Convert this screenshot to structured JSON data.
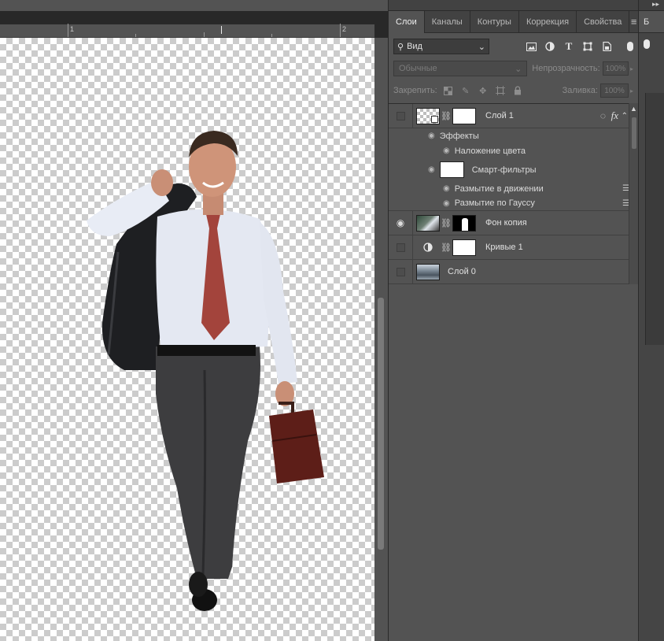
{
  "panel": {
    "tabs": [
      {
        "label": "Слои",
        "active": true
      },
      {
        "label": "Каналы",
        "active": false
      },
      {
        "label": "Контуры",
        "active": false
      },
      {
        "label": "Коррекция",
        "active": false
      },
      {
        "label": "Свойства",
        "active": false
      }
    ],
    "menu_icon": "hamburger-menu-icon",
    "filter": {
      "label": "Вид",
      "icons": [
        "image-filter-icon",
        "adjustment-filter-icon",
        "type-filter-icon",
        "shape-filter-icon",
        "smart-object-filter-icon"
      ]
    },
    "blend_mode": "Обычные",
    "opacity": {
      "label": "Непрозрачность:",
      "value": "100%"
    },
    "lock": {
      "label": "Закрепить:",
      "icons": [
        "lock-transparency-icon",
        "lock-paint-icon",
        "lock-position-icon",
        "lock-artboard-icon",
        "lock-all-icon"
      ]
    },
    "fill": {
      "label": "Заливка:",
      "value": "100%"
    },
    "layers": [
      {
        "name": "Слой 1",
        "visible": false,
        "type": "smart-object",
        "effects": {
          "effects_label": "Эффекты",
          "color_overlay": "Наложение цвета",
          "smart_filters": "Смарт-фильтры",
          "filters": [
            "Размытие в движении",
            "Размытие по Гауссу"
          ]
        }
      },
      {
        "name": "Фон копия",
        "visible": true,
        "type": "photo-with-mask"
      },
      {
        "name": "Кривые 1",
        "visible": false,
        "type": "adjustment"
      },
      {
        "name": "Слой 0",
        "visible": false,
        "type": "photo"
      }
    ]
  },
  "ruler": {
    "labels": [
      "1",
      "2"
    ]
  },
  "strip": {
    "top_label": "▸▸",
    "tab_label": "Б"
  },
  "colors": {
    "panel_bg": "#535353",
    "canvas_bg": "#282828",
    "active_tab": "#535353",
    "tab_bar": "#424242"
  }
}
